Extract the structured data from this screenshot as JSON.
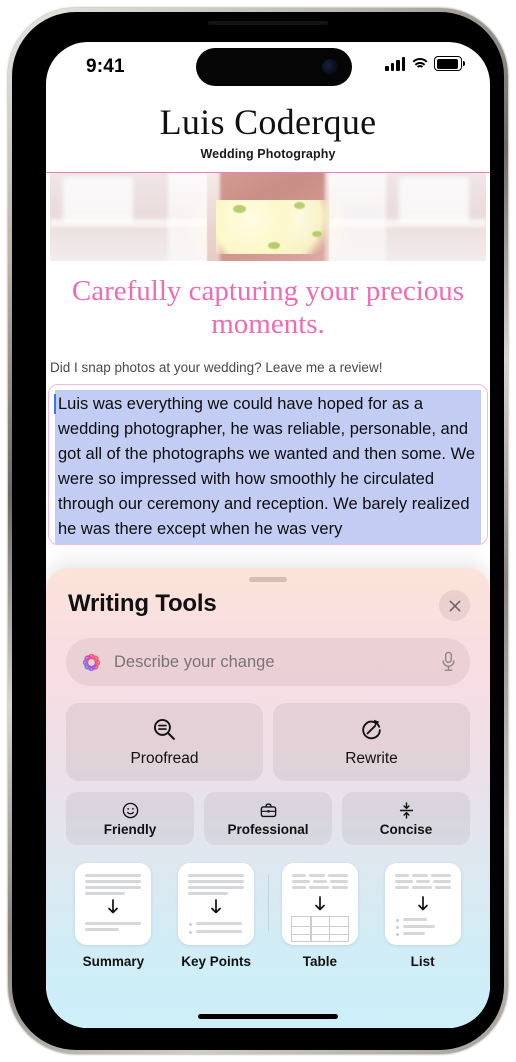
{
  "status_bar": {
    "time": "9:41",
    "cellular_icon": "signal-bars-icon",
    "wifi_icon": "wifi-icon",
    "battery_icon": "battery-icon"
  },
  "website": {
    "title": "Luis Coderque",
    "subtitle": "Wedding Photography",
    "hero_image_alt": "bride-holding-white-bouquet",
    "headline": "Carefully capturing your precious moments.",
    "prompt": "Did I snap photos at your wedding? Leave me a review!",
    "review_text": "Luis was everything we could have hoped for as a wedding photographer, he was reliable, personable, and got all of the photographs we wanted and then some. We were so impressed with how smoothly he circulated through our ceremony and reception. We barely realized he was there except when he was very",
    "accent_color": "#f06bb4",
    "selection_color": "#c3cdf4",
    "caret_color": "#2f7cf6"
  },
  "writing_tools": {
    "title": "Writing Tools",
    "close_icon": "close-icon",
    "grabber": "sheet-grabber",
    "input": {
      "placeholder": "Describe your change",
      "value": "",
      "leading_icon": "apple-intelligence-icon",
      "trailing_icon": "microphone-icon"
    },
    "primary_actions": [
      {
        "label": "Proofread",
        "icon": "magnifier-lines-icon"
      },
      {
        "label": "Rewrite",
        "icon": "rewrite-circular-arrow-icon"
      }
    ],
    "tone_actions": [
      {
        "label": "Friendly",
        "icon": "smiley-face-icon"
      },
      {
        "label": "Professional",
        "icon": "briefcase-icon"
      },
      {
        "label": "Concise",
        "icon": "compress-arrows-icon"
      }
    ],
    "transform_actions": [
      {
        "label": "Summary",
        "icon": "document-summary-icon"
      },
      {
        "label": "Key Points",
        "icon": "document-key-points-icon"
      },
      {
        "label": "Table",
        "icon": "document-table-icon"
      },
      {
        "label": "List",
        "icon": "document-list-icon"
      }
    ]
  },
  "home_indicator": "home-indicator"
}
